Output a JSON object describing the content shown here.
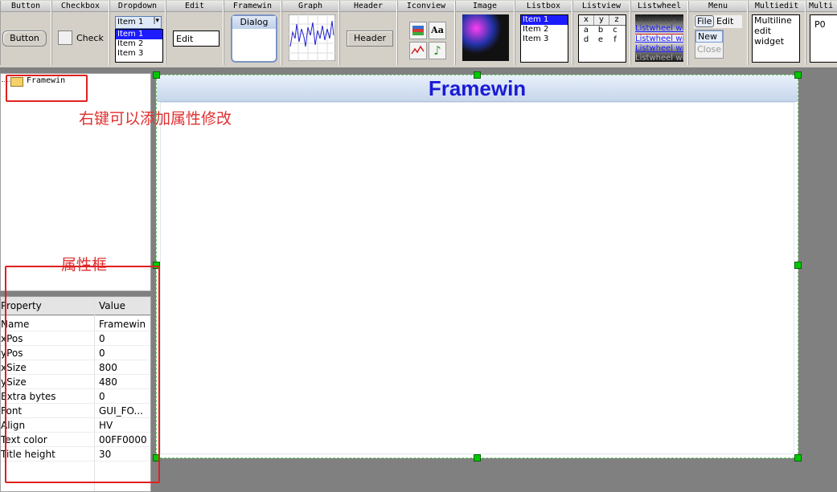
{
  "colors": {
    "accent_red": "#e02020",
    "title_blue": "#1a1ad6",
    "selection": "#1c1cff",
    "handle_green": "#00c800"
  },
  "palette": {
    "button": {
      "title": "Button",
      "label": "Button"
    },
    "checkbox": {
      "title": "Checkbox",
      "label": "Check"
    },
    "dropdown": {
      "title": "Dropdown",
      "selected": "Item 1",
      "items": [
        "Item 1",
        "Item 2",
        "Item 3"
      ]
    },
    "edit": {
      "title": "Edit",
      "value": "Edit"
    },
    "framewin": {
      "title": "Framewin",
      "label": "Dialog"
    },
    "graph": {
      "title": "Graph"
    },
    "header": {
      "title": "Header",
      "label": "Header"
    },
    "iconview": {
      "title": "Iconview",
      "font_icon": "Aa"
    },
    "image": {
      "title": "Image"
    },
    "listbox": {
      "title": "Listbox",
      "items": [
        "Item 1",
        "Item 2",
        "Item 3"
      ]
    },
    "listview": {
      "title": "Listview",
      "headers": [
        "x",
        "y",
        "z"
      ],
      "rows": [
        [
          "a",
          "b",
          "c"
        ],
        [
          "d",
          "e",
          "f"
        ]
      ]
    },
    "listwheel": {
      "title": "Listwheel",
      "items": [
        "Listwheel wid",
        "Listwheel wid",
        "Listwheel wid",
        "Listwheel wid",
        "Listwheel wid"
      ]
    },
    "menu": {
      "title": "Menu",
      "items": [
        "File",
        "Edit"
      ],
      "sub_items": [
        "New",
        "Close"
      ]
    },
    "multiedit": {
      "title": "Multiedit",
      "lines": [
        "Multiline",
        "edit",
        "widget"
      ]
    },
    "multipage": {
      "title": "Multi",
      "label": "P0"
    }
  },
  "tree": {
    "root": "Framewin"
  },
  "annotations": {
    "tree_note": "右键可以添加属性修改",
    "props_note": "属性框"
  },
  "properties": {
    "header_property": "Property",
    "header_value": "Value",
    "rows": [
      {
        "name": "Name",
        "value": "Framewin"
      },
      {
        "name": "xPos",
        "value": "0"
      },
      {
        "name": "yPos",
        "value": "0"
      },
      {
        "name": "xSize",
        "value": "800"
      },
      {
        "name": "ySize",
        "value": "480"
      },
      {
        "name": "Extra bytes",
        "value": "0"
      },
      {
        "name": "Font",
        "value": "GUI_FO..."
      },
      {
        "name": "Align",
        "value": "HV"
      },
      {
        "name": "Text color",
        "value": "00FF0000"
      },
      {
        "name": "Title height",
        "value": "30"
      }
    ]
  },
  "canvas": {
    "framewin_title": "Framewin"
  }
}
